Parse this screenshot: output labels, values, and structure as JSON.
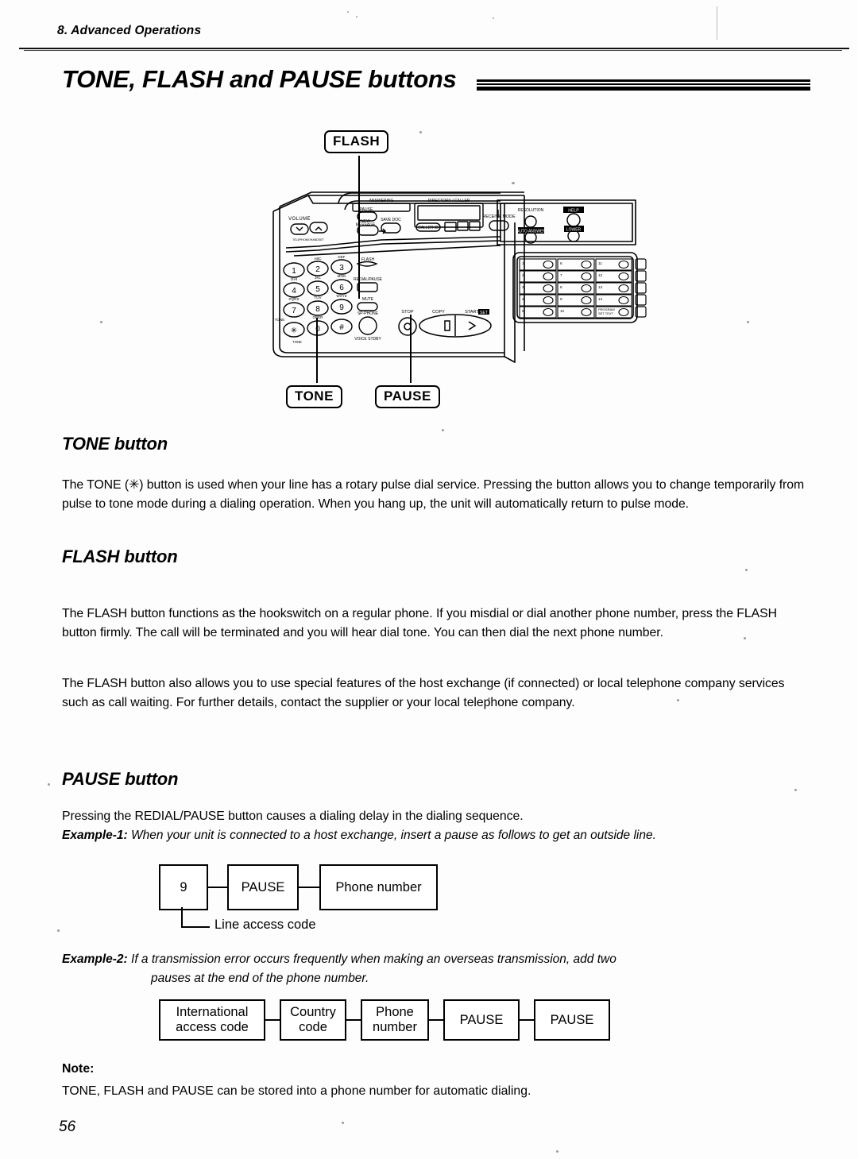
{
  "document": {
    "running_head": "8.  Advanced Operations",
    "title": "TONE, FLASH and PAUSE buttons",
    "page_number": "56"
  },
  "figure": {
    "callouts": {
      "flash": "FLASH",
      "tone": "TONE",
      "pause": "PAUSE"
    },
    "panel": {
      "volume_label": "VOLUME",
      "flash_button": "FLASH",
      "redial_pause_button": "REDIAL/PAUSE",
      "tone_label": "TONE",
      "receive_mode": "RECEIVE MODE",
      "resolution": "RESOLUTION",
      "help": "HELP",
      "stop": "STOP",
      "copy": "COPY",
      "start": "START",
      "keypad": [
        "1",
        "2",
        "3",
        "4",
        "5",
        "6",
        "7",
        "8",
        "9",
        "*",
        "0",
        "#"
      ],
      "keypad_letters": [
        "",
        "ABC",
        "DEF",
        "GHI",
        "JKL",
        "MNO",
        "PQRS",
        "TUV",
        "WXYZ",
        "",
        "OPER",
        ""
      ],
      "one_touch_labels": [
        "1",
        "6",
        "11",
        "2",
        "7",
        "12",
        "3",
        "8",
        "13",
        "4",
        "9",
        "14",
        "5",
        "10",
        "PROGRAM"
      ]
    }
  },
  "sections": {
    "tone": {
      "heading": "TONE button",
      "paragraph": "The TONE (✳) button is used when your line has a rotary pulse dial service. Pressing the button allows you to change temporarily from pulse to tone mode during a dialing operation. When you hang up, the unit will automatically return to pulse mode."
    },
    "flash": {
      "heading": "FLASH button",
      "paragraph_1": "The FLASH button functions as the hookswitch on a regular phone. If you misdial or dial another phone number, press the FLASH button firmly. The call will be terminated and you will hear dial tone. You can then dial the next phone number.",
      "paragraph_2": "The FLASH button also allows you to use special features of the host exchange (if connected) or local telephone company services such as call waiting. For further details, contact the supplier or your local telephone company."
    },
    "pause": {
      "heading": "PAUSE button",
      "paragraph": "Pressing the REDIAL/PAUSE button causes a dialing delay in the dialing sequence.",
      "example_1": {
        "label": "Example-1:",
        "text": "When your unit is connected to a host exchange, insert a pause as follows to get an outside line.",
        "boxes": [
          "9",
          "PAUSE",
          "Phone number"
        ],
        "annotation": "Line access code"
      },
      "example_2": {
        "label": "Example-2:",
        "text_line_1": "If a transmission error occurs frequently when making an overseas transmission, add two",
        "text_line_2": "pauses at the end of the phone number.",
        "boxes": [
          "International access code",
          "Country code",
          "Phone number",
          "PAUSE",
          "PAUSE"
        ]
      }
    }
  },
  "note": {
    "label": "Note:",
    "text": "TONE, FLASH and PAUSE can be stored into a phone number for automatic dialing."
  }
}
